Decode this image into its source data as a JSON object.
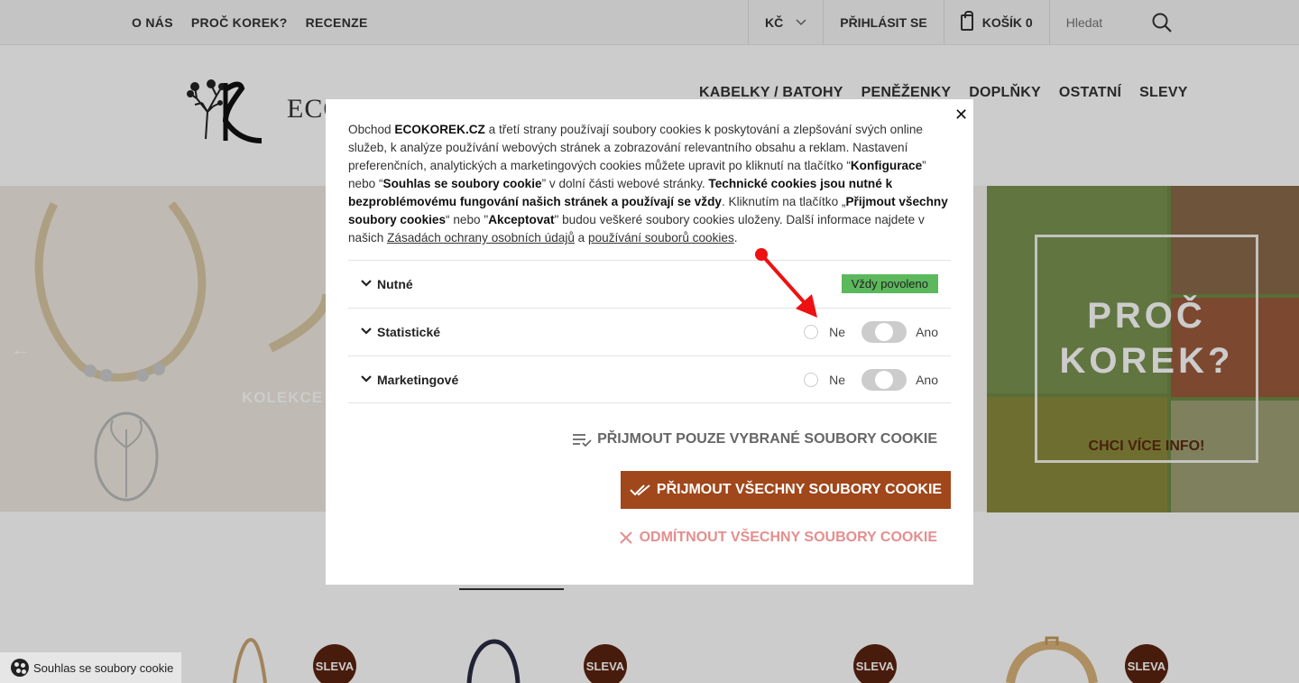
{
  "topbar": {
    "nav": [
      "O NÁS",
      "PROČ KOREK?",
      "RECENZE"
    ],
    "currency": "KČ",
    "login": "PŘIHLÁSIT SE",
    "cart": "KOŠÍK 0",
    "search_placeholder": "Hledat"
  },
  "header": {
    "logo_text": "ECOKOREK",
    "nav": [
      "KABELKY / BATOHY",
      "PENĚŽENKY",
      "DOPLŇKY",
      "OSTATNÍ",
      "SLEVY"
    ]
  },
  "hero": {
    "left_text": "KOLEKCE",
    "right_title": "PROČ KOREK?",
    "right_link": "CHCI VÍCE INFO!"
  },
  "products": {
    "badge": "SLEVA"
  },
  "cookie_corner": {
    "label": "Souhlas se soubory cookie"
  },
  "modal": {
    "intro": {
      "p1": "Obchod ",
      "shop": "ECOKOREK.CZ",
      "p2": " a třetí strany používají soubory cookies k poskytování a zlepšování svých online služeb, k analýze používání webových stránek a zobrazování relevantního obsahu a reklam. Nastavení preferenčních, analytických a marketingových cookies můžete upravit po kliknutí na tlačítko “",
      "config": "Konfigurace",
      "p3": "” nebo “",
      "consent": "Souhlas se soubory cookie",
      "p4": "” v dolní části webové stránky. ",
      "technical": "Technické cookies jsou nutné k bezproblémovému fungování našich stránek a používají se vždy",
      "p5": ". Kliknutím na tlačítko „",
      "accept_all_q": "Přijmout všechny soubory cookies",
      "p6": "“ nebo \"",
      "accept": "Akceptovat",
      "p7": "\" budou veškeré soubory cookies uloženy. Další informace najdete v našich ",
      "link1": "Zásadách ochrany osobních údajů",
      "p8": " a ",
      "link2": "používání souborů cookies",
      "p9": "."
    },
    "categories": [
      {
        "name": "Nutné",
        "status": "Vždy povoleno"
      },
      {
        "name": "Statistické",
        "no": "Ne",
        "yes": "Ano"
      },
      {
        "name": "Marketingové",
        "no": "Ne",
        "yes": "Ano"
      }
    ],
    "btn_selected": "PŘIJMOUT POUZE VYBRANÉ SOUBORY COOKIE",
    "btn_all": "PŘIJMOUT VŠECHNY SOUBORY COOKIE",
    "btn_reject": "ODMÍTNOUT VŠECHNY SOUBORY COOKIE",
    "close": "✕"
  },
  "colors": {
    "accent": "#a0471b",
    "badge": "#5b2410",
    "always_on": "#5cb85c",
    "reject": "#e48e8e"
  }
}
